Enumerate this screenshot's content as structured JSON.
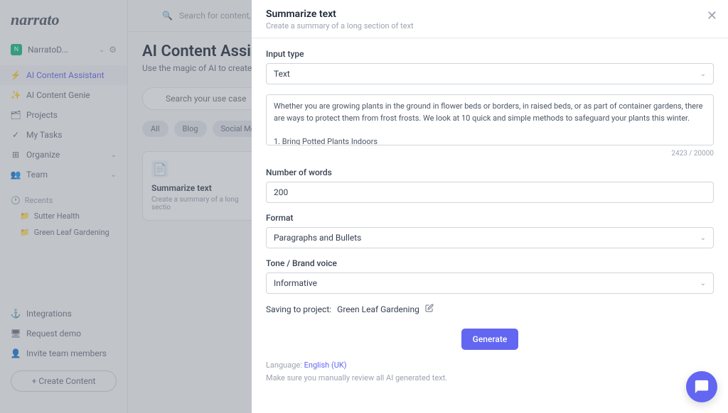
{
  "logo": "narrato",
  "workspace": {
    "name": "NarratoD...",
    "avatar": "N"
  },
  "nav": {
    "assistant": "AI Content Assistant",
    "genie": "AI Content Genie",
    "projects": "Projects",
    "tasks": "My Tasks",
    "organize": "Organize",
    "team": "Team"
  },
  "recents": {
    "header": "Recents",
    "items": [
      "Sutter Health",
      "Green Leaf Gardening"
    ]
  },
  "bottom_nav": {
    "integrations": "Integrations",
    "request_demo": "Request demo",
    "invite": "Invite team members",
    "create": "+ Create Content"
  },
  "main": {
    "search_placeholder": "Search for content, projects, a",
    "title": "AI Content Assistant",
    "subtitle": "Use the magic of AI to create",
    "usecase_placeholder": "Search your use case",
    "chips": [
      "All",
      "Blog",
      "Social Media"
    ],
    "card": {
      "title": "Summarize text",
      "desc": "Create a summary of a long sectio"
    }
  },
  "modal": {
    "title": "Summarize text",
    "subtitle": "Create a summary of a long section of text",
    "input_type_label": "Input type",
    "input_type_value": "Text",
    "text_value": "Whether you are growing plants in the ground in flower beds or borders, in raised beds, or as part of container gardens, there are ways to protect them from frost frosts. We look at 10 quick and simple methods to safeguard your plants this winter.\n\n1. Bring Potted Plants Indoors",
    "char_count": "2423 / 20000",
    "words_label": "Number of words",
    "words_value": "200",
    "format_label": "Format",
    "format_value": "Paragraphs and Bullets",
    "tone_label": "Tone / Brand voice",
    "tone_value": "Informative",
    "saving_label": "Saving to project:",
    "saving_value": "Green Leaf Gardening",
    "generate": "Generate",
    "language_label": "Language:",
    "language_value": "English (UK)",
    "review_note": "Make sure you manually review all AI generated text."
  }
}
